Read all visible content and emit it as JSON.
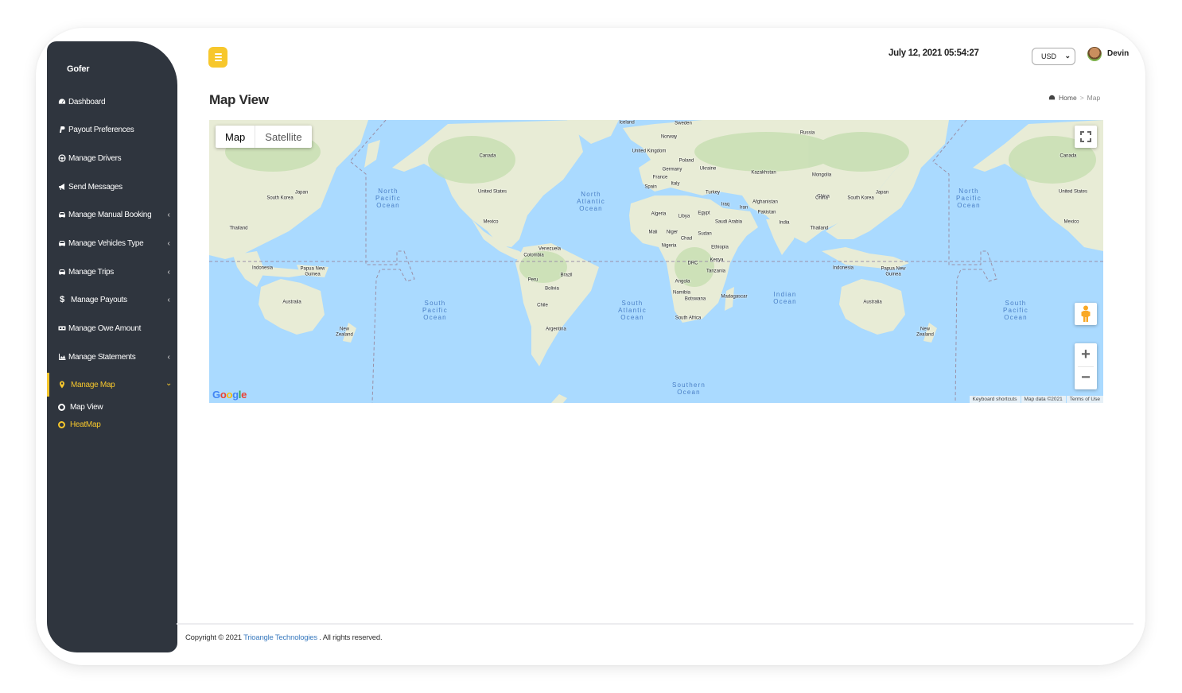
{
  "app": {
    "brand": "Gofer"
  },
  "sidebar": {
    "items": [
      {
        "label": "Dashboard",
        "icon": "dashboard-icon",
        "has_children": false
      },
      {
        "label": "Payout Preferences",
        "icon": "paypal-icon",
        "has_children": false
      },
      {
        "label": "Manage Drivers",
        "icon": "steering-wheel-icon",
        "has_children": false
      },
      {
        "label": "Send Messages",
        "icon": "megaphone-icon",
        "has_children": false
      },
      {
        "label": "Manage Manual Booking",
        "icon": "car-icon",
        "has_children": true
      },
      {
        "label": "Manage Vehicles Type",
        "icon": "car-icon",
        "has_children": true
      },
      {
        "label": "Manage Trips",
        "icon": "car-icon",
        "has_children": true
      },
      {
        "label": "Manage Payouts",
        "icon": "dollar-icon",
        "has_children": true
      },
      {
        "label": "Manage Owe Amount",
        "icon": "money-icon",
        "has_children": false
      },
      {
        "label": "Manage Statements",
        "icon": "area-chart-icon",
        "has_children": true
      },
      {
        "label": "Manage Map",
        "icon": "map-marker-icon",
        "has_children": true,
        "active": true
      }
    ],
    "subitems": [
      {
        "label": "Map View"
      },
      {
        "label": "HeatMap"
      }
    ],
    "chevron_collapsed": "‹",
    "chevron_expanded": "⌄"
  },
  "header": {
    "datetime": "July 12, 2021 05:54:27",
    "currency": {
      "selected": "USD"
    },
    "user": {
      "name": "Devin"
    }
  },
  "page": {
    "title": "Map View",
    "breadcrumb": {
      "home": "Home",
      "separator": ">",
      "current": "Map"
    }
  },
  "map": {
    "type_buttons": {
      "map": "Map",
      "satellite": "Satellite"
    },
    "selected_type": "Map",
    "zoom_in": "+",
    "zoom_out": "−",
    "logo": "Google",
    "attribution": [
      "Keyboard shortcuts",
      "Map data ©2021",
      "Terms of Use"
    ],
    "country_labels": [
      "Iceland",
      "Sweden",
      "Norway",
      "Russia",
      "United Kingdom",
      "Poland",
      "Germany",
      "Ukraine",
      "France",
      "Italy",
      "Spain",
      "Kazakhstan",
      "Mongolia",
      "China",
      "Turkey",
      "Iraq",
      "Iran",
      "Afghanistan",
      "Pakistan",
      "India",
      "Algeria",
      "Libya",
      "Egypt",
      "Saudi Arabia",
      "Mali",
      "Niger",
      "Chad",
      "Sudan",
      "Nigeria",
      "Ethiopia",
      "Kenya",
      "DRC",
      "Tanzania",
      "Angola",
      "Namibia",
      "Botswana",
      "Madagascar",
      "South Africa",
      "Canada",
      "United States",
      "Mexico",
      "Venezuela",
      "Colombia",
      "Brazil",
      "Peru",
      "Bolivia",
      "Chile",
      "Argentina",
      "Japan",
      "South Korea",
      "Thailand",
      "Indonesia",
      "Papua New Guinea",
      "Australia",
      "New Zealand"
    ],
    "ocean_labels": [
      "North Pacific Ocean",
      "North Atlantic Ocean",
      "South Pacific Ocean",
      "South Atlantic Ocean",
      "Indian Ocean",
      "Southern Ocean"
    ]
  },
  "footer": {
    "prefix": "Copyright © 2021",
    "company": "Trioangle Technologies",
    "suffix": ". All rights reserved."
  },
  "colors": {
    "accent": "#f7c72c",
    "sidebar_bg": "#2f353e",
    "link": "#3b7bbf",
    "water": "#aadaff",
    "land": "#f0ecdc",
    "forest": "#c8e0b4"
  }
}
